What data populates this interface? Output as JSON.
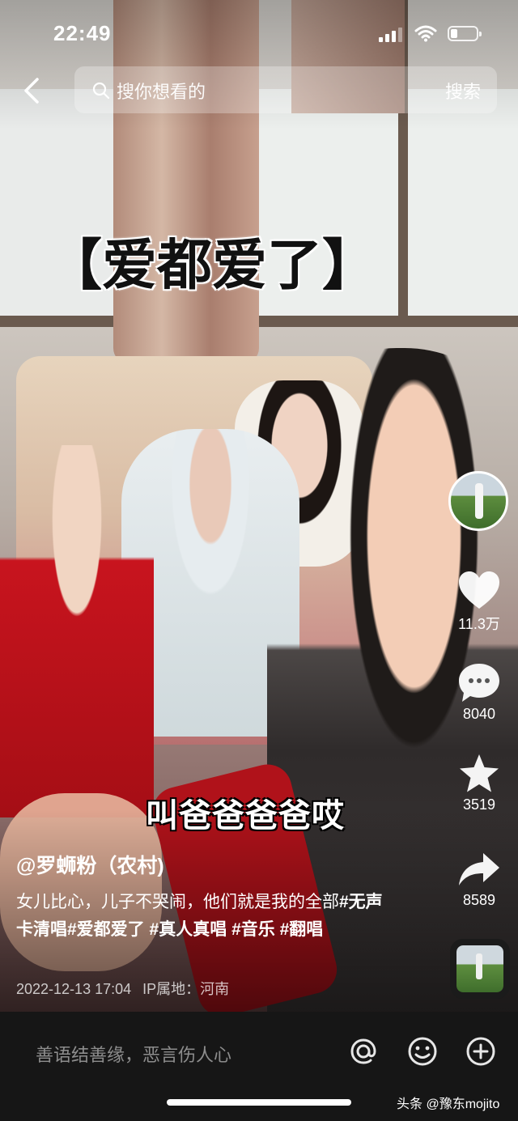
{
  "status_bar": {
    "time": "22:49",
    "signal_bars": 3,
    "battery_level": 0.25
  },
  "search": {
    "placeholder": "搜你想看的",
    "button_label": "搜索"
  },
  "video": {
    "overlay_title": "【爱都爱了】",
    "lyric_subtitle": "叫爸爸爸爸哎"
  },
  "rail": {
    "like_count": "11.3万",
    "comment_count": "8040",
    "favorite_count": "3519",
    "share_count": "8589"
  },
  "post": {
    "author": "@罗蛳粉（农村)",
    "caption_text": "女儿比心，儿子不哭闹，他们就是我的全部",
    "hashtags": [
      "#无声卡清唱",
      "#爱都爱了",
      "#真人真唱",
      "#音乐",
      "#翻唱"
    ],
    "date": "2022-12-13 17:04",
    "ip_location": "IP属地：河南"
  },
  "bottom_bar": {
    "comment_placeholder": "善语结善缘，恶言伤人心"
  },
  "watermark": "头条 @豫东mojito",
  "colors": {
    "bottom_bg": "#161616",
    "accent_red": "#c8141e"
  },
  "icons": [
    "back-icon",
    "search-icon",
    "heart-icon",
    "comment-icon",
    "star-icon",
    "share-icon",
    "at-icon",
    "emoji-icon",
    "plus-icon"
  ]
}
